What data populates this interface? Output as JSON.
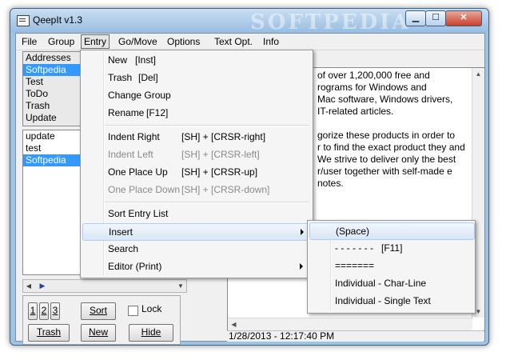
{
  "window": {
    "title": "QeepIt v1.3",
    "watermark": "SOFTPEDIA",
    "buttons": {
      "minimize": "▁",
      "maximize": "☐",
      "close": "✕"
    }
  },
  "menubar": [
    "File",
    "Group",
    "Entry",
    "Go/Move",
    "Options",
    "Text Opt.",
    "Info"
  ],
  "groups": [
    "Addresses",
    "Softpedia",
    "Test",
    "ToDo",
    "Trash",
    "Update"
  ],
  "entries": [
    "update",
    "test",
    "Softpedia"
  ],
  "buttons": {
    "num": [
      "1",
      "2",
      "3"
    ],
    "sort": "Sort",
    "lock": "Lock",
    "trash": "Trash",
    "new": "New",
    "hide": "Hide"
  },
  "text_lines": [
    "of over 1,200,000 free and",
    "rograms for Windows and",
    "Mac software, Windows drivers,",
    "IT-related articles.",
    "",
    "gorize these products in order to",
    "r to find the exact product they and",
    "We strive to deliver only the best",
    "r/user together with self-made e",
    "notes."
  ],
  "status": "1/28/2013 - 12:17:40 PM",
  "entry_menu": [
    {
      "label": "New",
      "shortcut": "[Inst]",
      "enabled": true
    },
    {
      "label": "Trash",
      "shortcut": "[Del]",
      "enabled": true
    },
    {
      "label": "Change Group",
      "shortcut": "",
      "enabled": true
    },
    {
      "label": "Rename",
      "shortcut": "[F12]",
      "enabled": true
    },
    {
      "label": "Indent Right",
      "shortcut": "[SH] + [CRSR-right]",
      "enabled": true
    },
    {
      "label": "Indent Left",
      "shortcut": "[SH] + [CRSR-left]",
      "enabled": false
    },
    {
      "label": "One Place Up",
      "shortcut": "[SH] + [CRSR-up]",
      "enabled": true
    },
    {
      "label": "One Place Down",
      "shortcut": "[SH] + [CRSR-down]",
      "enabled": false
    },
    {
      "label": "Sort Entry List",
      "shortcut": "",
      "enabled": true
    },
    {
      "label": "Insert",
      "shortcut": "",
      "enabled": true
    },
    {
      "label": "Search",
      "shortcut": "",
      "enabled": true
    },
    {
      "label": "Editor (Print)",
      "shortcut": "",
      "enabled": true
    }
  ],
  "insert_menu": [
    {
      "label": "(Space)"
    },
    {
      "label": "- - - - - - -   [F11]"
    },
    {
      "label": "======="
    },
    {
      "label": "Individual - Char-Line"
    },
    {
      "label": "Individual - Single Text"
    }
  ]
}
